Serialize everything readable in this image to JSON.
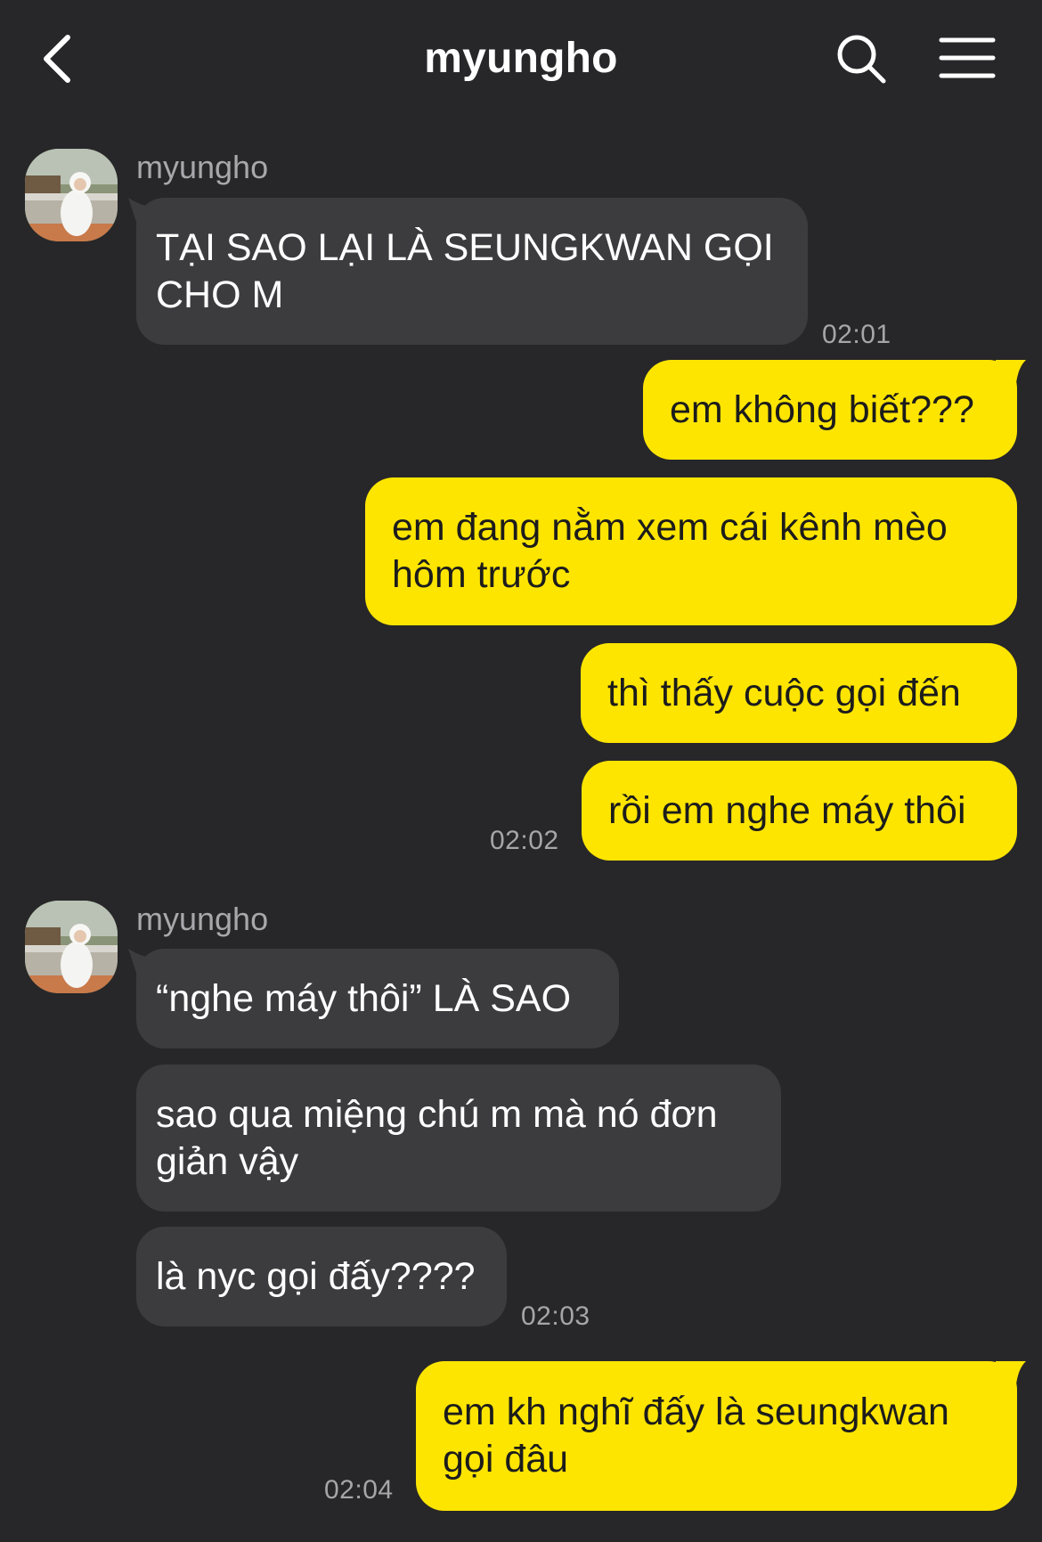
{
  "header": {
    "title": "myungho",
    "back_icon": "chevron-left-icon",
    "search_icon": "search-icon",
    "menu_icon": "menu-icon"
  },
  "colors": {
    "background": "#272729",
    "incoming_bubble": "#3c3c3f",
    "outgoing_bubble": "#fee500",
    "timestamp": "#a6a6aa"
  },
  "messages": [
    {
      "sender": "myungho",
      "direction": "incoming",
      "lines": [
        "TẠI SAO LẠI LÀ SEUNGKWAN GỌI",
        "CHO M"
      ],
      "time": "02:01"
    },
    {
      "direction": "outgoing",
      "lines": [
        "em không biết???"
      ]
    },
    {
      "direction": "outgoing",
      "lines": [
        "em đang nằm xem cái kênh mèo",
        "hôm trước"
      ]
    },
    {
      "direction": "outgoing",
      "lines": [
        "thì thấy cuộc gọi đến"
      ]
    },
    {
      "direction": "outgoing",
      "lines": [
        "rồi em nghe máy thôi"
      ],
      "time": "02:02"
    },
    {
      "sender": "myungho",
      "direction": "incoming",
      "lines": [
        "“nghe máy thôi” LÀ SAO"
      ]
    },
    {
      "direction": "incoming",
      "lines": [
        "sao qua miệng chú m mà nó đơn",
        "giản vậy"
      ]
    },
    {
      "direction": "incoming",
      "lines": [
        "là nyc gọi đấy????"
      ],
      "time": "02:03"
    },
    {
      "direction": "outgoing",
      "lines": [
        "em kh nghĩ đấy là seungkwan",
        "gọi đâu"
      ],
      "time": "02:04"
    }
  ]
}
